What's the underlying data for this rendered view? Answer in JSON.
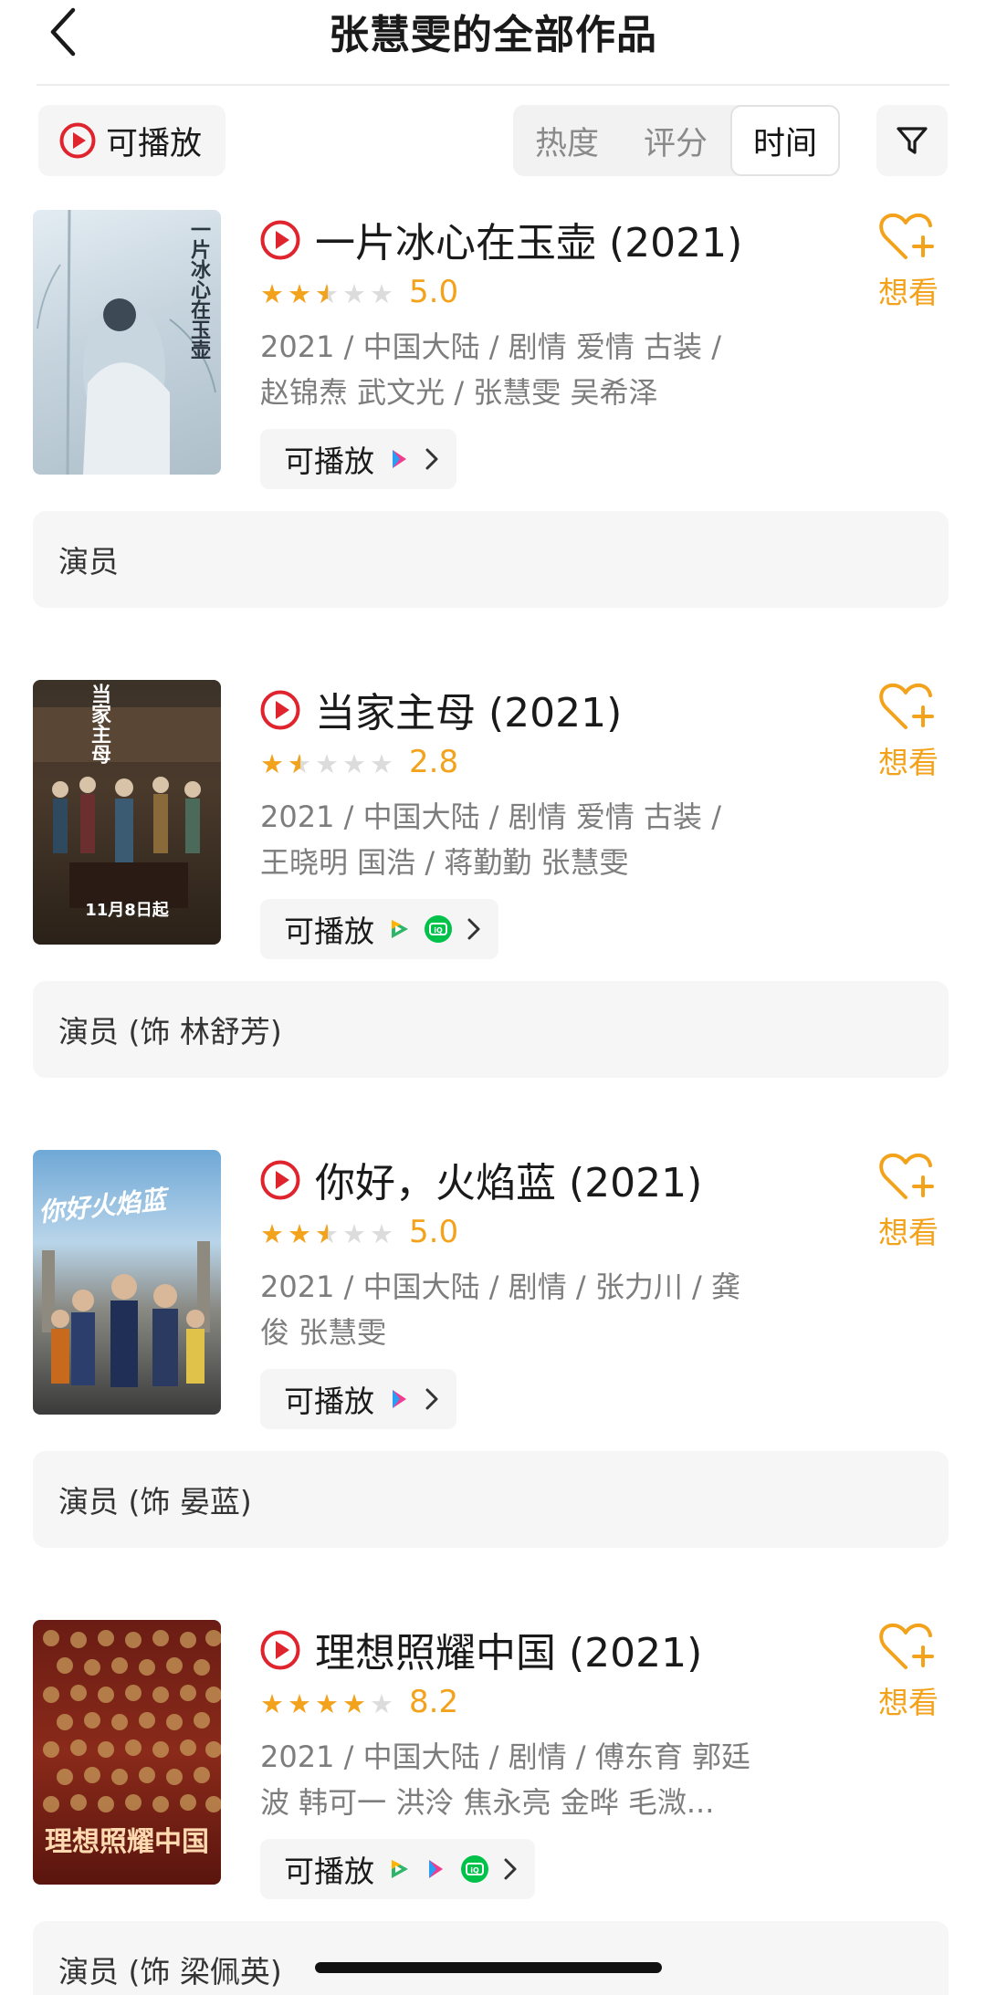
{
  "header": {
    "title": "张慧雯的全部作品"
  },
  "filter_bar": {
    "playable_label": "可播放",
    "sort_tabs": [
      "热度",
      "评分",
      "时间"
    ],
    "active_sort": "时间"
  },
  "colors": {
    "accent": "#f3a21b",
    "play_red": "#e0242e",
    "chip_bg": "#f5f5f5"
  },
  "films": [
    {
      "title": "一片冰心在玉壶 (2021)",
      "stars": 2.5,
      "rating": "5.0",
      "meta_line1": "2021 / 中国大陆 / 剧情 爱情 古装 /",
      "meta_line2": "赵锦焘 武文光 / 张慧雯 吴希泽",
      "play_label": "可播放",
      "platforms": [
        "youku-icon"
      ],
      "want_label": "想看",
      "role": "演员",
      "poster_text": "一片冰心在玉壶"
    },
    {
      "title": "当家主母 (2021)",
      "stars": 1.5,
      "rating": "2.8",
      "meta_line1": "2021 / 中国大陆 / 剧情 爱情 古装 /",
      "meta_line2": "王晓明 国浩 / 蒋勤勤 张慧雯",
      "play_label": "可播放",
      "platforms": [
        "tencent-video-icon",
        "iqiyi-icon"
      ],
      "want_label": "想看",
      "role": "演员 (饰 林舒芳)",
      "poster_text": "当家主母",
      "poster_subtext": "11月8日起"
    },
    {
      "title": "你好，火焰蓝 (2021)",
      "stars": 2.5,
      "rating": "5.0",
      "meta_line1": "2021 / 中国大陆 / 剧情 / 张力川 / 龚",
      "meta_line2": "俊 张慧雯",
      "play_label": "可播放",
      "platforms": [
        "youku-icon"
      ],
      "want_label": "想看",
      "role": "演员 (饰 晏蓝)",
      "poster_text": "你好火焰蓝"
    },
    {
      "title": "理想照耀中国 (2021)",
      "stars": 4,
      "rating": "8.2",
      "meta_line1": "2021 / 中国大陆 / 剧情 / 傅东育 郭廷",
      "meta_line2": "波 韩可一 洪泠 焦永亮 金晔 毛溦...",
      "play_label": "可播放",
      "platforms": [
        "tencent-video-icon",
        "youku-icon",
        "iqiyi-icon"
      ],
      "want_label": "想看",
      "role": "演员 (饰 梁佩英)",
      "poster_text": "理想照耀中国"
    }
  ]
}
